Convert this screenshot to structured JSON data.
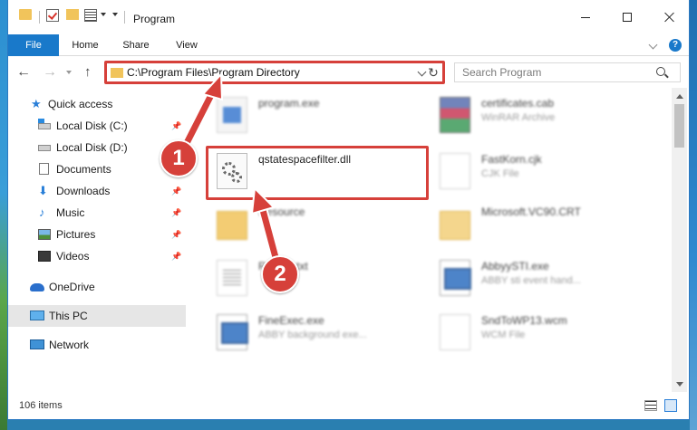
{
  "window": {
    "title": "Program"
  },
  "ribbon": {
    "tabs": [
      "File",
      "Home",
      "Share",
      "View"
    ]
  },
  "nav": {
    "address": "C:\\Program Files\\Program Directory",
    "search_placeholder": "Search Program"
  },
  "sidebar": {
    "items": [
      {
        "label": "Quick access",
        "icon": "star-icon"
      },
      {
        "label": "Local Disk (C:)",
        "icon": "drive-c-icon",
        "pinned": true
      },
      {
        "label": "Local Disk (D:)",
        "icon": "drive-d-icon",
        "pinned": true
      },
      {
        "label": "Documents",
        "icon": "documents-icon",
        "pinned": true
      },
      {
        "label": "Downloads",
        "icon": "downloads-icon",
        "pinned": true
      },
      {
        "label": "Music",
        "icon": "music-icon",
        "pinned": true
      },
      {
        "label": "Pictures",
        "icon": "pictures-icon",
        "pinned": true
      },
      {
        "label": "Videos",
        "icon": "videos-icon",
        "pinned": true
      },
      {
        "label": "OneDrive",
        "icon": "onedrive-icon"
      },
      {
        "label": "This PC",
        "icon": "this-pc-icon",
        "selected": true
      },
      {
        "label": "Network",
        "icon": "network-icon"
      }
    ]
  },
  "files": [
    {
      "name": "program.exe",
      "type": "",
      "icon": "exe-icon"
    },
    {
      "name": "certificates.cab",
      "type": "WinRAR Archive",
      "icon": "cab-archive-icon"
    },
    {
      "name": "qstatespacefilter.dll",
      "type": "",
      "icon": "dll-gear-icon",
      "highlighted": true
    },
    {
      "name": "FastKorn.cjk",
      "type": "CJK File",
      "icon": "file-icon"
    },
    {
      "name": "Resource",
      "type": "",
      "icon": "folder-icon"
    },
    {
      "name": "Microsoft.VC90.CRT",
      "type": "",
      "icon": "folder-open-icon"
    },
    {
      "name": "Reader.txt",
      "type": "",
      "icon": "text-file-icon"
    },
    {
      "name": "AbbyySTI.exe",
      "type": "ABBY sti event hand...",
      "icon": "app-icon"
    },
    {
      "name": "FineExec.exe",
      "type": "ABBY background exe...",
      "icon": "app-icon"
    },
    {
      "name": "SndToWP13.wcm",
      "type": "WCM File",
      "icon": "file-icon"
    }
  ],
  "status": {
    "item_count": "106 items"
  },
  "callouts": {
    "step1": "1",
    "step2": "2"
  },
  "colors": {
    "accent": "#1979ca",
    "highlight": "#d6403a",
    "selected_row": "#e6e6e6"
  }
}
